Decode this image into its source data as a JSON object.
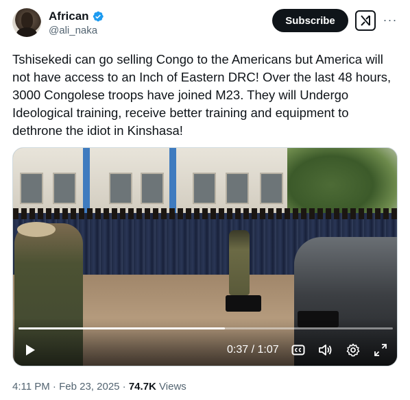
{
  "author": {
    "name": "African",
    "handle": "@ali_naka",
    "verified": true,
    "avatar_icon": "avatar-portrait"
  },
  "actions": {
    "subscribe_label": "Subscribe",
    "grok_icon": "grok-icon",
    "more_icon": "more-icon",
    "more_glyph": "···"
  },
  "tweet": {
    "text": "Tshisekedi can go selling Congo to the Americans but America will not have access to an Inch of Eastern DRC! Over the last 48 hours, 3000 Congolese troops have joined M23. They will Undergo Ideological training, receive better training and equipment to dethrone the idiot in Kinshasa!"
  },
  "video": {
    "current_time": "0:37",
    "separator": " / ",
    "duration": "1:07",
    "progress": 0.552,
    "controls": [
      "play-icon",
      "captions-icon",
      "volume-icon",
      "settings-icon",
      "fullscreen-icon"
    ]
  },
  "meta": {
    "time": "4:11 PM",
    "dot1": " · ",
    "date": "Feb 23, 2025",
    "dot2": " · ",
    "views_count": "74.7K",
    "views_label": " Views"
  },
  "colors": {
    "primary_text": "#0f1419",
    "secondary_text": "#536471",
    "verified_blue": "#1d9bf0",
    "button_dark": "#0f1419"
  }
}
